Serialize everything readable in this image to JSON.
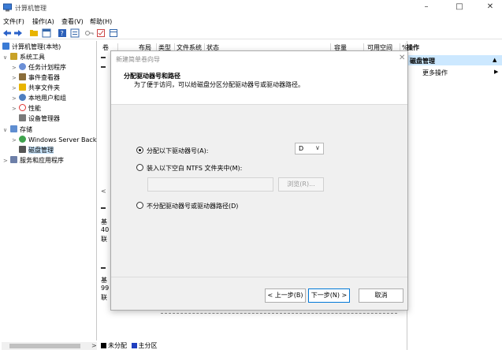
{
  "window": {
    "title": "计算机管理",
    "min": "–",
    "max": "□",
    "close": "✕"
  },
  "menu": [
    "文件(F)",
    "操作(A)",
    "查看(V)",
    "帮助(H)"
  ],
  "tree": {
    "root": "计算机管理(本地)",
    "system_tools": "系统工具",
    "task_scheduler": "任务计划程序",
    "event_viewer": "事件查看器",
    "shared_folders": "共享文件夹",
    "local_users": "本地用户和组",
    "performance": "性能",
    "device_manager": "设备管理器",
    "storage": "存储",
    "windows_server_backup": "Windows Server Back",
    "disk_management": "磁盘管理",
    "services_apps": "服务和应用程序"
  },
  "columns": [
    "卷",
    "布局",
    "类型",
    "文件系统",
    "状态",
    "容量",
    "可用空间",
    "%"
  ],
  "left_peek": [
    "基",
    "40",
    "联",
    "基",
    "99",
    "联"
  ],
  "legend": {
    "unallocated": "未分配",
    "primary": "主分区",
    "unallocated_color": "#000000",
    "primary_color": "#1f3fbf"
  },
  "actions": {
    "header": "操作",
    "selected": "磁盘管理",
    "more": "更多操作"
  },
  "dialog": {
    "title": "新建简单卷向导",
    "close": "✕",
    "heading": "分配驱动器号和路径",
    "subheading": "为了便于访问，可以给磁盘分区分配驱动器号或驱动器路径。",
    "option_assign": "分配以下驱动器号(A):",
    "drive_letter": "D",
    "option_mount": "装入以下空白 NTFS 文件夹中(M):",
    "folder_value": "",
    "browse": "浏览(R)...",
    "option_none": "不分配驱动器号或驱动器路径(D)",
    "back": "< 上一步(B)",
    "next": "下一步(N) >",
    "cancel": "取消"
  }
}
